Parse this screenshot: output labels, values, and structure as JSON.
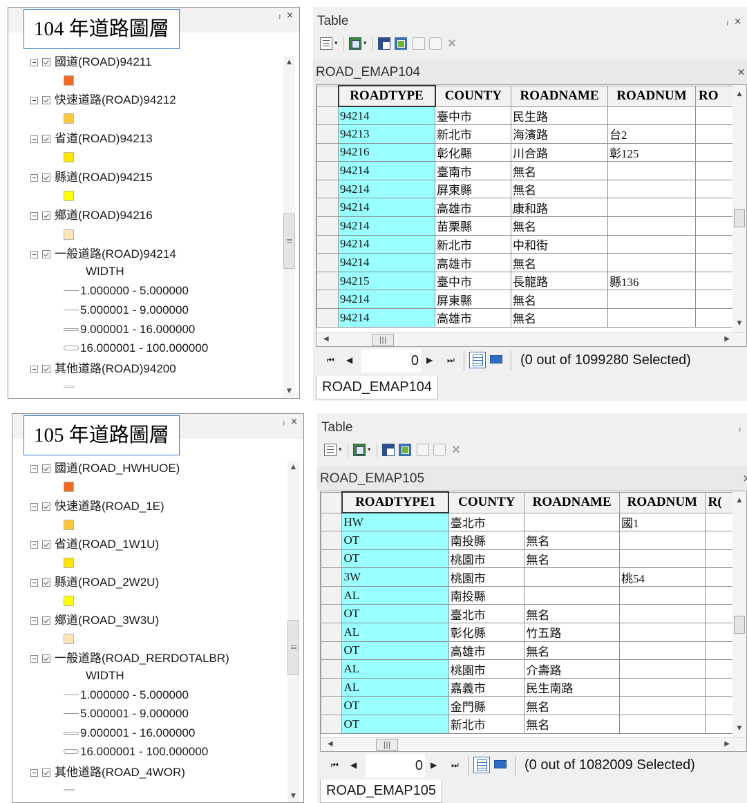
{
  "pin_close": "ⱼ ×",
  "toc_panels": [
    {
      "year_label": "104 年道路圖層",
      "layers": [
        {
          "label": "國道(ROAD)94211",
          "swatch": "#ef6a23"
        },
        {
          "label": "快速道路(ROAD)94212",
          "swatch": "#ffc83c"
        },
        {
          "label": "省道(ROAD)94213",
          "swatch": "#ffe600"
        },
        {
          "label": "縣道(ROAD)94215",
          "swatch": "#ffff00"
        },
        {
          "label": "鄉道(ROAD)94216",
          "swatch": "#fde5b8"
        }
      ],
      "general_road": "一般道路(ROAD)94214",
      "width_label": "WIDTH",
      "ranges": [
        "1.000000 - 5.000000",
        "5.000001 - 9.000000",
        "9.000001 - 16.000000",
        "16.000001 - 100.000000"
      ],
      "other_road": "其他道路(ROAD)94200"
    },
    {
      "year_label": "105 年道路圖層",
      "layers": [
        {
          "label": "國道(ROAD_HWHUOE)",
          "swatch": "#ef6a23"
        },
        {
          "label": "快速道路(ROAD_1E)",
          "swatch": "#ffc83c"
        },
        {
          "label": "省道(ROAD_1W1U)",
          "swatch": "#ffe600"
        },
        {
          "label": "縣道(ROAD_2W2U)",
          "swatch": "#ffff00"
        },
        {
          "label": "鄉道(ROAD_3W3U)",
          "swatch": "#fde5b8"
        }
      ],
      "general_road": "一般道路(ROAD_RERDOTALBR)",
      "width_label": "WIDTH",
      "ranges": [
        "1.000000 - 5.000000",
        "5.000001 - 9.000000",
        "9.000001 - 16.000000",
        "16.000001 - 100.000000"
      ],
      "other_road": "其他道路(ROAD_4WOR)"
    }
  ],
  "tables": [
    {
      "window_title": "Table",
      "table_name": "ROAD_EMAP104",
      "close": "×",
      "columns": [
        "ROADTYPE",
        "COUNTY",
        "ROADNAME",
        "ROADNUM",
        "RO"
      ],
      "rows": [
        [
          "94214",
          "臺中市",
          "民生路",
          ""
        ],
        [
          "94213",
          "新北市",
          "海濱路",
          "台2"
        ],
        [
          "94216",
          "彰化縣",
          "川合路",
          "彰125"
        ],
        [
          "94214",
          "臺南市",
          "無名",
          ""
        ],
        [
          "94214",
          "屏東縣",
          "無名",
          ""
        ],
        [
          "94214",
          "高雄市",
          "康和路",
          ""
        ],
        [
          "94214",
          "苗栗縣",
          "無名",
          ""
        ],
        [
          "94214",
          "新北市",
          "中和街",
          ""
        ],
        [
          "94214",
          "高雄市",
          "無名",
          ""
        ],
        [
          "94215",
          "臺中市",
          "長龍路",
          "縣136"
        ],
        [
          "94214",
          "屏東縣",
          "無名",
          ""
        ],
        [
          "94214",
          "高雄市",
          "無名",
          ""
        ]
      ],
      "record_number": "0",
      "selection_status": "(0 out of 1099280 Selected)"
    },
    {
      "window_title": "Table",
      "table_name": "ROAD_EMAP105",
      "close": "×",
      "columns": [
        "ROADTYPE1",
        "COUNTY",
        "ROADNAME",
        "ROADNUM",
        "R("
      ],
      "rows": [
        [
          "HW",
          "臺北市",
          "",
          "國1"
        ],
        [
          "OT",
          "南投縣",
          "無名",
          ""
        ],
        [
          "OT",
          "桃園市",
          "無名",
          ""
        ],
        [
          "3W",
          "桃園市",
          "",
          "桃54"
        ],
        [
          "AL",
          "南投縣",
          "",
          ""
        ],
        [
          "OT",
          "臺北市",
          "無名",
          ""
        ],
        [
          "AL",
          "彰化縣",
          "竹五路",
          ""
        ],
        [
          "OT",
          "高雄市",
          "無名",
          ""
        ],
        [
          "AL",
          "桃園市",
          "介壽路",
          ""
        ],
        [
          "AL",
          "嘉義市",
          "民生南路",
          ""
        ],
        [
          "OT",
          "金門縣",
          "無名",
          ""
        ],
        [
          "OT",
          "新北市",
          "無名",
          ""
        ]
      ],
      "record_number": "0",
      "selection_status": "(0 out of 1082009 Selected)"
    }
  ]
}
